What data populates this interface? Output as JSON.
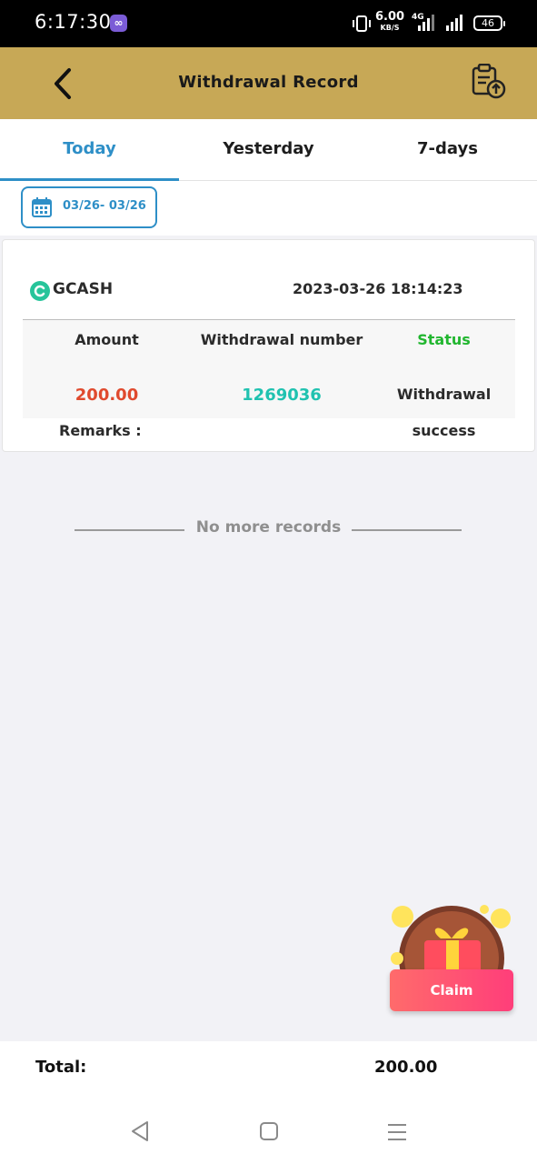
{
  "status_bar": {
    "time": "6:17:30",
    "net_speed": "6.00",
    "net_unit": "KB/S",
    "network_type": "4G",
    "battery": "46"
  },
  "header": {
    "title": "Withdrawal Record",
    "back_icon": "chevron-left-icon",
    "right_icon": "clipboard-upload-icon"
  },
  "tabs": [
    {
      "label": "Today",
      "active": true
    },
    {
      "label": "Yesterday",
      "active": false
    },
    {
      "label": "7-days",
      "active": false
    }
  ],
  "date_filter": {
    "range": "03/26- 03/26",
    "icon": "calendar-icon"
  },
  "record": {
    "channel": "GCASH",
    "datetime": "2023-03-26 18:14:23",
    "columns": [
      "Amount",
      "Withdrawal number",
      "Status"
    ],
    "amount": "200.00",
    "withdrawal_number": "1269036",
    "status_line1": "Withdrawal",
    "status_line2": "success",
    "remarks_label": "Remarks :"
  },
  "no_more_text": "No more records",
  "claim": {
    "label": "Claim"
  },
  "footer": {
    "total_label": "Total:",
    "total_value": "200.00"
  },
  "colors": {
    "header_bg": "#c7a856",
    "accent_blue": "#2e8fc7",
    "amount_red": "#e04a2e",
    "number_teal": "#20c2b0",
    "status_green": "#21b62f"
  }
}
